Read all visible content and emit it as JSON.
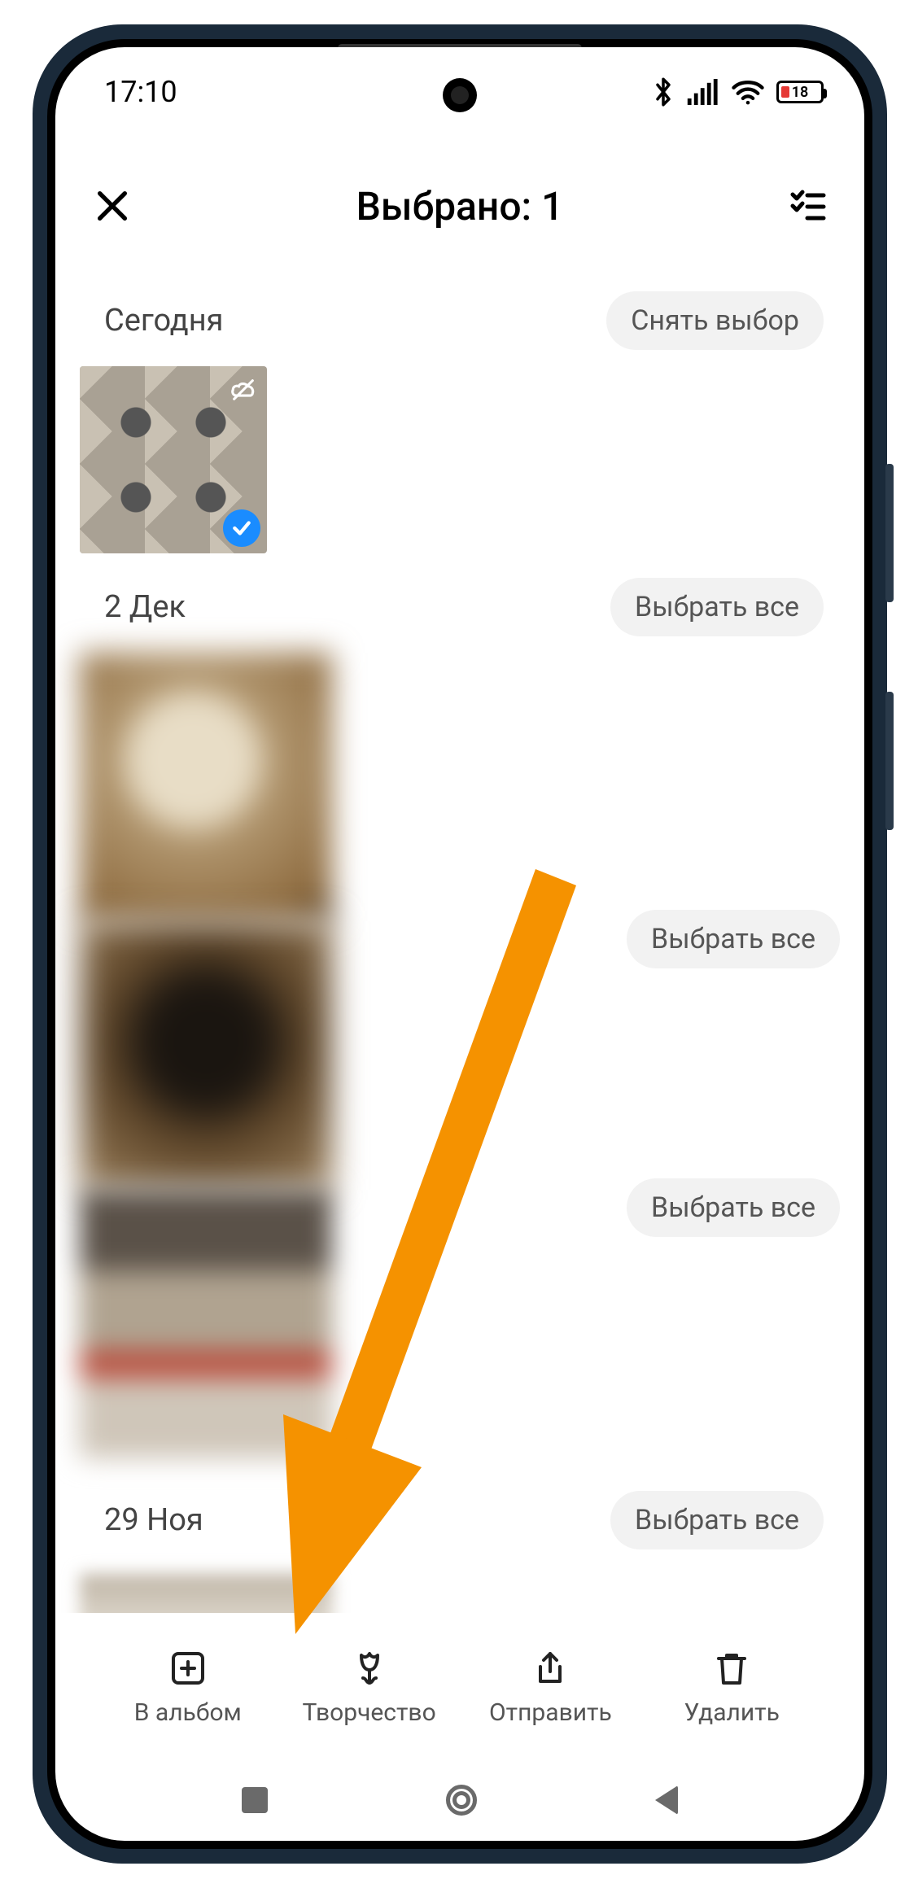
{
  "status": {
    "time": "17:10",
    "battery_pct": "18"
  },
  "appbar": {
    "title": "Выбрано: 1"
  },
  "sections": [
    {
      "date": "Сегодня",
      "action": "Снять выбор",
      "thumb_selected": true
    },
    {
      "date": "2 Дек",
      "action": "Выбрать все"
    },
    {
      "date": "29 Ноя",
      "action": "Выбрать все"
    }
  ],
  "floating_actions": {
    "a": "Выбрать все",
    "b": "Выбрать все"
  },
  "toolbar": {
    "album": "В альбом",
    "creative": "Творчество",
    "send": "Отправить",
    "delete": "Удалить"
  },
  "colors": {
    "accent": "#1a8cff",
    "arrow": "#f59200"
  },
  "icons": {
    "close": "close-icon",
    "checklist": "checklist-icon",
    "cloud_off": "cloud-off-icon",
    "check": "checkmark-icon",
    "add_box": "add-to-album-icon",
    "tulip": "creativity-icon",
    "share": "share-icon",
    "trash": "trash-icon",
    "bluetooth": "bluetooth-icon",
    "signal": "signal-icon",
    "wifi": "wifi-icon"
  }
}
